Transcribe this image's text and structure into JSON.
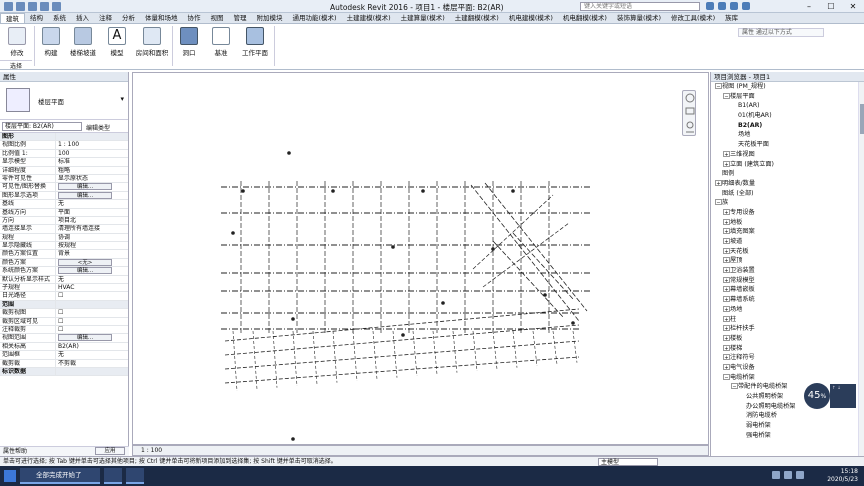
{
  "titlebar": {
    "title": "Autodesk Revit 2016 -     项目1 - 楼层平面: B2(AR)",
    "search_placeholder": "键入关键字或短语"
  },
  "tabs": [
    "建筑",
    "结构",
    "系统",
    "插入",
    "注释",
    "分析",
    "体量和场地",
    "协作",
    "视图",
    "管理",
    "附加模块",
    "通用功能(模术)",
    "土建建模(模术)",
    "土建算量(模术)",
    "土建翻模(模术)",
    "机电建模(模术)",
    "机电翻模(模术)",
    "装饰算量(模术)",
    "修改工具(模术)",
    "族库"
  ],
  "active_tab": 0,
  "ribbon": {
    "buttons": [
      "修改",
      "构建",
      "楼梯坡道",
      "模型",
      "房间和面积",
      "洞口",
      "基准",
      "工作平面"
    ],
    "select_label": "选择",
    "right_box": "属性 通过以下方式"
  },
  "props": {
    "header": "属性",
    "type_name": "楼层平面",
    "filter": "楼层平面: B2(AR)",
    "edit_type": "编辑类型",
    "rows": [
      {
        "k": "图形",
        "v": "",
        "cat": true
      },
      {
        "k": "视图比例",
        "v": "1 : 100"
      },
      {
        "k": "比例值 1:",
        "v": "100"
      },
      {
        "k": "显示模型",
        "v": "标准"
      },
      {
        "k": "详细程度",
        "v": "粗略"
      },
      {
        "k": "零件可见性",
        "v": "显示原状态"
      },
      {
        "k": "可见性/图形替换",
        "v": "编辑...",
        "btn": true
      },
      {
        "k": "图形显示选项",
        "v": "编辑...",
        "btn": true
      },
      {
        "k": "基线",
        "v": "无"
      },
      {
        "k": "基线方向",
        "v": "平面"
      },
      {
        "k": "方向",
        "v": "项目北"
      },
      {
        "k": "墙连接显示",
        "v": "清理所有墙连接"
      },
      {
        "k": "规程",
        "v": "协调"
      },
      {
        "k": "显示隐藏线",
        "v": "按规程"
      },
      {
        "k": "颜色方案位置",
        "v": "背景"
      },
      {
        "k": "颜色方案",
        "v": "<无>",
        "btn": true
      },
      {
        "k": "系统颜色方案",
        "v": "编辑...",
        "btn": true
      },
      {
        "k": "默认分析显示样式",
        "v": "无"
      },
      {
        "k": "子规程",
        "v": "HVAC"
      },
      {
        "k": "日光路径",
        "v": "☐"
      },
      {
        "k": "范围",
        "v": "",
        "cat": true
      },
      {
        "k": "裁剪视图",
        "v": "☐"
      },
      {
        "k": "裁剪区域可见",
        "v": "☐"
      },
      {
        "k": "注释裁剪",
        "v": "☐"
      },
      {
        "k": "视图范围",
        "v": "编辑...",
        "btn": true
      },
      {
        "k": "相关标高",
        "v": "B2(AR)"
      },
      {
        "k": "范围框",
        "v": "无"
      },
      {
        "k": "截剪裁",
        "v": "不剪裁"
      },
      {
        "k": "标识数据",
        "v": "",
        "cat": true
      }
    ],
    "help": "属性帮助",
    "apply": "应用"
  },
  "viewbar": {
    "scale": "1 : 100"
  },
  "browser": {
    "header": "项目浏览器 - 项目1",
    "rows": [
      {
        "t": "视图 (PM_规程)",
        "lvl": 0,
        "exp": "−"
      },
      {
        "t": "楼层平面",
        "lvl": 1,
        "exp": "−"
      },
      {
        "t": "B1(AR)",
        "lvl": 2,
        "exp": ""
      },
      {
        "t": "01(机电AR)",
        "lvl": 2,
        "exp": ""
      },
      {
        "t": "B2(AR)",
        "lvl": 2,
        "exp": "",
        "bold": true
      },
      {
        "t": "场地",
        "lvl": 2,
        "exp": ""
      },
      {
        "t": "天花板平面",
        "lvl": 2,
        "exp": ""
      },
      {
        "t": "三维视图",
        "lvl": 1,
        "exp": "+"
      },
      {
        "t": "立面 (建筑立面)",
        "lvl": 1,
        "exp": "+"
      },
      {
        "t": "图例",
        "lvl": 0,
        "exp": ""
      },
      {
        "t": "明细表/数量",
        "lvl": 0,
        "exp": "+"
      },
      {
        "t": "图纸 (全部)",
        "lvl": 0,
        "exp": ""
      },
      {
        "t": "族",
        "lvl": 0,
        "exp": "−"
      },
      {
        "t": "专用设备",
        "lvl": 1,
        "exp": "+"
      },
      {
        "t": "地板",
        "lvl": 1,
        "exp": "+"
      },
      {
        "t": "填充图案",
        "lvl": 1,
        "exp": "+"
      },
      {
        "t": "坡道",
        "lvl": 1,
        "exp": "+"
      },
      {
        "t": "天花板",
        "lvl": 1,
        "exp": "+"
      },
      {
        "t": "屋顶",
        "lvl": 1,
        "exp": "+"
      },
      {
        "t": "卫浴装置",
        "lvl": 1,
        "exp": "+"
      },
      {
        "t": "常规模型",
        "lvl": 1,
        "exp": "+"
      },
      {
        "t": "幕墙嵌板",
        "lvl": 1,
        "exp": "+"
      },
      {
        "t": "幕墙系统",
        "lvl": 1,
        "exp": "+"
      },
      {
        "t": "场地",
        "lvl": 1,
        "exp": "+"
      },
      {
        "t": "柱",
        "lvl": 1,
        "exp": "+"
      },
      {
        "t": "栏杆扶手",
        "lvl": 1,
        "exp": "+"
      },
      {
        "t": "楼板",
        "lvl": 1,
        "exp": "+"
      },
      {
        "t": "楼梯",
        "lvl": 1,
        "exp": "+"
      },
      {
        "t": "注释符号",
        "lvl": 1,
        "exp": "+"
      },
      {
        "t": "电气设备",
        "lvl": 1,
        "exp": "+"
      },
      {
        "t": "电缆桥架",
        "lvl": 1,
        "exp": "−"
      },
      {
        "t": "带配件的电缆桥架",
        "lvl": 2,
        "exp": "−"
      },
      {
        "t": "公共照明桥架",
        "lvl": 3,
        "exp": ""
      },
      {
        "t": "办公照明电缆桥架",
        "lvl": 3,
        "exp": ""
      },
      {
        "t": "消防电缆桥",
        "lvl": 3,
        "exp": ""
      },
      {
        "t": "弱电桥架",
        "lvl": 3,
        "exp": ""
      },
      {
        "t": "强电桥架",
        "lvl": 3,
        "exp": ""
      }
    ]
  },
  "status": {
    "text": "单击可进行选择; 按 Tab 键并单击可选择其他项目; 按 Ctrl 键并单击可将新项目添加到选择集; 按 Shift 键并单击可取消选择。",
    "model": "主模型"
  },
  "taskbar": {
    "item": "全部完成开始了",
    "time": "15:18",
    "date": "2020/5/23"
  },
  "gauge": {
    "value": "45",
    "unit": "%"
  },
  "colors": {
    "accent": "#3c78d8",
    "panel": "#e2e8f0",
    "taskbar": "#1b2a45"
  }
}
